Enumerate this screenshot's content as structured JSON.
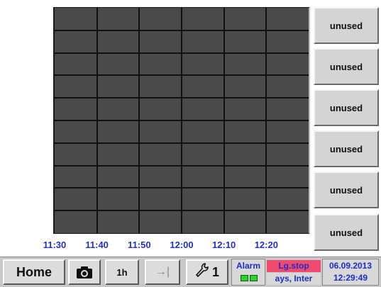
{
  "chart": {
    "time_ticks": [
      "11:30",
      "11:40",
      "11:50",
      "12:00",
      "12:10",
      "12:20"
    ],
    "colors": {
      "plot_bg": "#4a4a4a",
      "grid": "#111111",
      "tick_text": "#2030c8"
    }
  },
  "side_buttons": [
    {
      "label": "unused"
    },
    {
      "label": "unused"
    },
    {
      "label": "unused"
    },
    {
      "label": "unused"
    },
    {
      "label": "unused"
    },
    {
      "label": "unused"
    }
  ],
  "bottom_bar": {
    "home_label": "Home",
    "camera_icon": "camera-icon",
    "range_label": "1h",
    "jump_icon": "jump-to-end-icon",
    "jump_glyph": "→|",
    "settings_icon": "wrench-icon",
    "settings_glyph": "🔧",
    "settings_count": "1",
    "alarm_label": "Alarm",
    "alarm_leds": [
      "#2bd42b",
      "#2bd42b"
    ],
    "logger_status": "Lg.stop",
    "logger_status_color": "#f24a6e",
    "logger_info": "ays, Inter",
    "date": "06.09.2013",
    "time": "12:29:49"
  }
}
